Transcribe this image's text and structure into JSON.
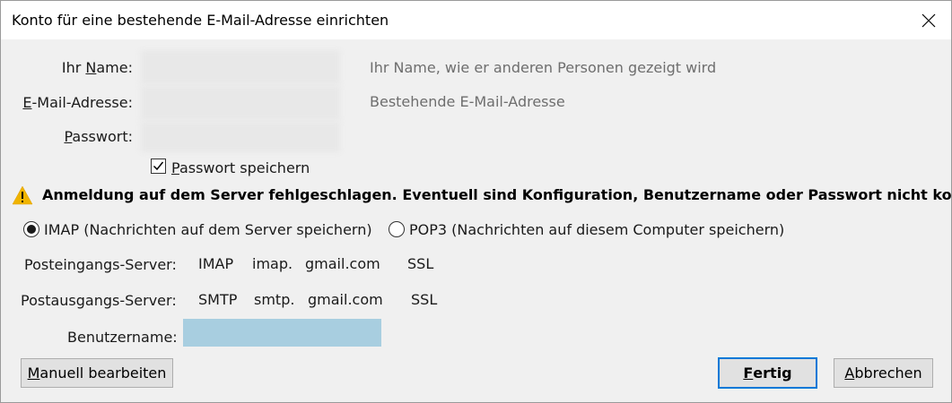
{
  "window": {
    "title": "Konto für eine bestehende E-Mail-Adresse einrichten"
  },
  "form": {
    "name_label_prefix": "Ihr ",
    "name_label_accel": "N",
    "name_label_suffix": "ame:",
    "name_hint": "Ihr Name, wie er anderen Personen gezeigt wird",
    "email_label_accel": "E",
    "email_label_suffix": "-Mail-Adresse:",
    "email_hint": "Bestehende E-Mail-Adresse",
    "password_label_accel": "P",
    "password_label_suffix": "asswort:",
    "save_password_accel": "P",
    "save_password_suffix": "asswort speichern",
    "save_password_checked": true
  },
  "warning": {
    "text": "Anmeldung auf dem Server fehlgeschlagen. Eventuell sind Konfiguration, Benutzername oder Passwort nicht korrekt."
  },
  "protocol": {
    "imap_label": "IMAP (Nachrichten auf dem Server speichern)",
    "pop3_label": "POP3 (Nachrichten auf diesem Computer speichern)",
    "selected": "IMAP"
  },
  "servers": {
    "incoming_label": "Posteingangs-Server:",
    "incoming_protocol": "IMAP",
    "incoming_host_prefix": "imap.",
    "incoming_host_domain": "gmail.com",
    "incoming_security": "SSL",
    "outgoing_label": "Postausgangs-Server:",
    "outgoing_protocol": "SMTP",
    "outgoing_host_prefix": "smtp.",
    "outgoing_host_domain": "gmail.com",
    "outgoing_security": "SSL",
    "username_label": "Benutzername:"
  },
  "buttons": {
    "manual_accel": "M",
    "manual_suffix": "anuell bearbeiten",
    "done_accel": "F",
    "done_suffix": "ertig",
    "cancel_accel": "A",
    "cancel_suffix": "bbrechen"
  },
  "colors": {
    "accent": "#0078d7",
    "warning": "#f0b400",
    "username_field": "#a8cee0"
  }
}
